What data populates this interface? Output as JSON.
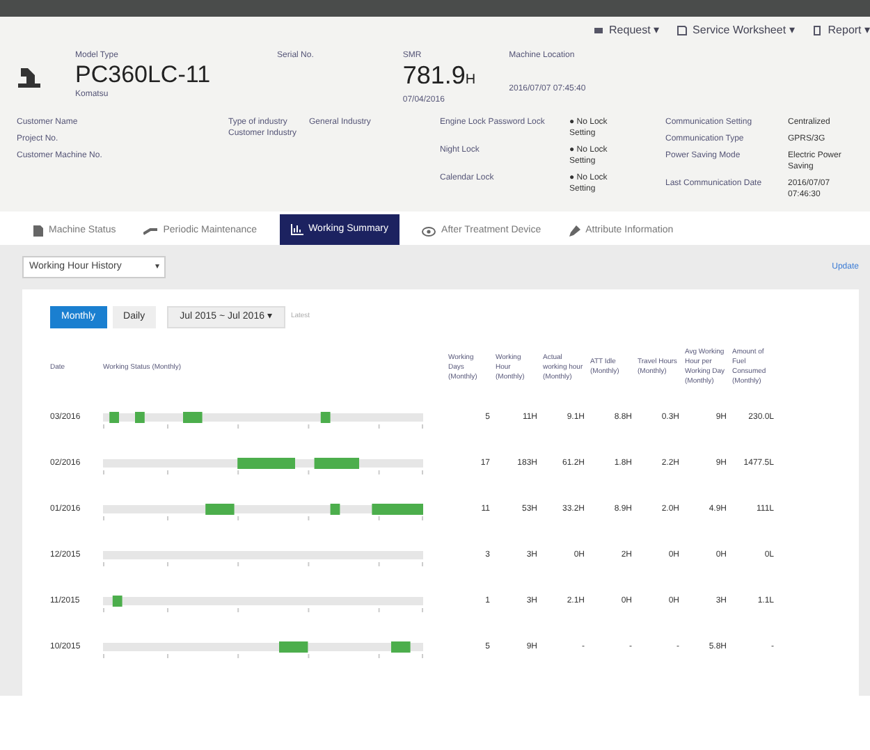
{
  "toolbar": [
    {
      "label": "Request ▾",
      "kind": "request"
    },
    {
      "label": "Service Worksheet ▾",
      "kind": "worksheet"
    },
    {
      "label": "Report ▾",
      "kind": "report"
    }
  ],
  "machine": {
    "model_label": "Model Type",
    "model": "PC360LC-11",
    "maker": "Komatsu",
    "serial_label": "Serial No.",
    "smr_label": "SMR",
    "smr_value": "781.9",
    "smr_unit": "H",
    "smr_date": "07/04/2016",
    "location_label": "Machine Location",
    "location_value": "2016/07/07 07:45:40"
  },
  "info_left": [
    {
      "label": "Customer Name"
    },
    {
      "label": "Project No."
    },
    {
      "label": "Customer Machine No."
    }
  ],
  "industry": {
    "label": "Type of industry",
    "value": "General Industry",
    "extra": "Customer Industry"
  },
  "locks": [
    {
      "label": "Engine Lock Password Lock",
      "status": "● No Lock Setting"
    },
    {
      "label": "Night Lock",
      "status": "● No Lock Setting"
    },
    {
      "label": "Calendar Lock",
      "status": "● No Lock Setting"
    }
  ],
  "communication": [
    {
      "label": "Communication Setting",
      "value": "Centralized"
    },
    {
      "label": "Communication Type",
      "value": "GPRS/3G"
    },
    {
      "label": "Power Saving Mode",
      "value": "Electric Power Saving"
    },
    {
      "label": "Last Communication Date",
      "value": "2016/07/07 07:46:30"
    }
  ],
  "tabs": [
    {
      "label": "Machine Status",
      "selected": false,
      "kind": "status"
    },
    {
      "label": "Periodic Maintenance",
      "selected": false,
      "kind": "maintenance"
    },
    {
      "label": "Working Summary",
      "selected": true,
      "kind": "summary"
    },
    {
      "label": "After Treatment Device",
      "selected": false,
      "kind": "device"
    },
    {
      "label": "Attribute Information",
      "selected": false,
      "kind": "attribute"
    }
  ],
  "view_select": {
    "value": "Working Hour History",
    "arrow": "▾"
  },
  "update_link": "Update",
  "period_buttons": [
    {
      "label": "Monthly",
      "selected": true
    },
    {
      "label": "Daily",
      "selected": false
    }
  ],
  "range_select": {
    "value": "Jul 2015 ~ Jul 2016 ▾"
  },
  "latest_link": "Latest",
  "table": {
    "columns": [
      "Date",
      "Working Status (Monthly)",
      "Working Days (Monthly)",
      "Working Hour (Monthly)",
      "Actual working hour (Monthly)",
      "ATT Idle (Monthly)",
      "Travel Hours (Monthly)",
      "Avg Working Hour per Working Day (Monthly)",
      "Amount of Fuel Consumed (Monthly)"
    ],
    "rows": [
      {
        "date": "03/2016",
        "working_days": "5",
        "working_hour": "11H",
        "actual_hour": "9.1H",
        "att_idle": "8.8H",
        "travel_hours": "0.3H",
        "avg_hour": "9H",
        "fuel": "230.0L"
      },
      {
        "date": "02/2016",
        "working_days": "17",
        "working_hour": "183H",
        "actual_hour": "61.2H",
        "att_idle": "1.8H",
        "travel_hours": "2.2H",
        "avg_hour": "9H",
        "fuel": "1477.5L"
      },
      {
        "date": "01/2016",
        "working_days": "11",
        "working_hour": "53H",
        "actual_hour": "33.2H",
        "att_idle": "8.9H",
        "travel_hours": "2.0H",
        "avg_hour": "4.9H",
        "fuel": "111L"
      },
      {
        "date": "12/2015",
        "working_days": "3",
        "working_hour": "3H",
        "actual_hour": "0H",
        "att_idle": "2H",
        "travel_hours": "0H",
        "avg_hour": "0H",
        "fuel": "0L"
      },
      {
        "date": "11/2015",
        "working_days": "1",
        "working_hour": "3H",
        "actual_hour": "2.1H",
        "att_idle": "0H",
        "travel_hours": "0H",
        "avg_hour": "3H",
        "fuel": "1.1L"
      },
      {
        "date": "10/2015",
        "working_days": "5",
        "working_hour": "9H",
        "actual_hour": "-",
        "att_idle": "-",
        "travel_hours": "-",
        "avg_hour": "5.8H",
        "fuel": "-"
      }
    ]
  }
}
